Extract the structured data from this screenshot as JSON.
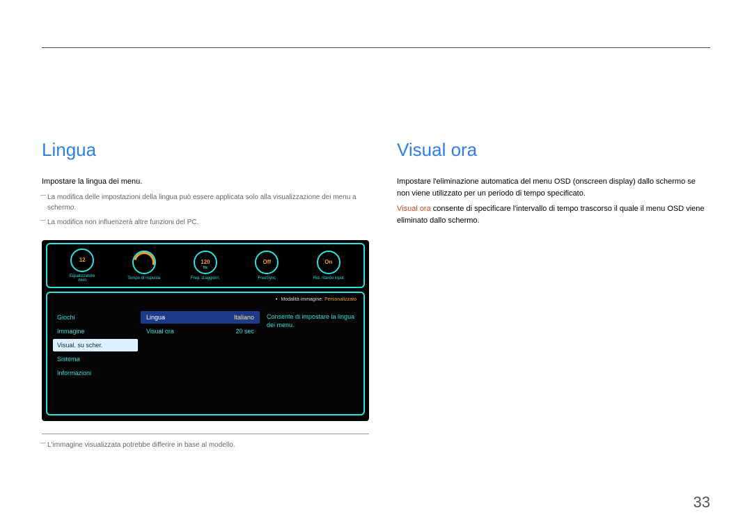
{
  "page_number": "33",
  "left": {
    "heading": "Lingua",
    "p1": "Impostare la lingua dei menu.",
    "note1": "La modifica delle impostazioni della lingua può essere applicata solo alla visualizzazione dei menu a schermo.",
    "note2": "La modifica non influenzerà altre funzioni del PC.",
    "footnote": "L'immagine visualizzata potrebbe differire in base al modello."
  },
  "right": {
    "heading": "Visual ora",
    "p1": "Impostare l'eliminazione automatica del menu OSD (onscreen display) dallo schermo se non viene utilizzato per un periodo di tempo specificato.",
    "p2_prefix": "Visual ora",
    "p2_rest": " consente di specificare l'intervallo di tempo trascorso il quale il menu OSD viene eliminato dallo schermo."
  },
  "osd": {
    "gauges": [
      {
        "value": "12",
        "sub": "",
        "label": "Equalizzatore nero"
      },
      {
        "value": "",
        "sub": "",
        "label": "Tempo di risposta"
      },
      {
        "value": "120",
        "sub": "Hz",
        "label": "Freq. d.aggiorn."
      },
      {
        "value": "Off",
        "sub": "",
        "label": "FreeSync"
      },
      {
        "value": "On",
        "sub": "",
        "label": "Rid. ritardo input"
      }
    ],
    "mode_label": "Modalità immagine:",
    "mode_value": "Personalizzato",
    "nav": [
      "Giochi",
      "Immagine",
      "Visual. su scher.",
      "Sistema",
      "Informazioni"
    ],
    "nav_active_index": 2,
    "menu": [
      {
        "label": "Lingua",
        "value": "Italiano",
        "selected": true
      },
      {
        "label": "Visual ora",
        "value": "20 sec",
        "selected": false
      }
    ],
    "description": "Consente di impostare la lingua dei menu."
  }
}
